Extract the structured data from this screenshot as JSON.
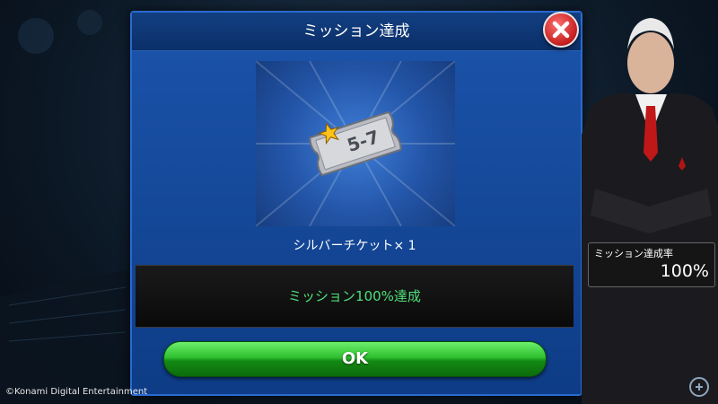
{
  "dialog": {
    "title": "ミッション達成",
    "close_icon": "close-icon"
  },
  "reward": {
    "ticket_text": "5-7",
    "label": "シルバーチケット× 1",
    "icons": [
      "star-icon",
      "silver-ticket-icon"
    ]
  },
  "status": {
    "message": "ミッション100%達成"
  },
  "ok_button": {
    "label": "OK"
  },
  "mission_rate": {
    "label": "ミッション達成率",
    "value": "100%"
  },
  "footer": {
    "copyright": "©Konami Digital Entertainment"
  },
  "colors": {
    "dialog_blue": "#0f3e86",
    "status_green": "#4fe07a",
    "ok_green": "#2fbf2f",
    "close_red": "#c41e1e"
  }
}
